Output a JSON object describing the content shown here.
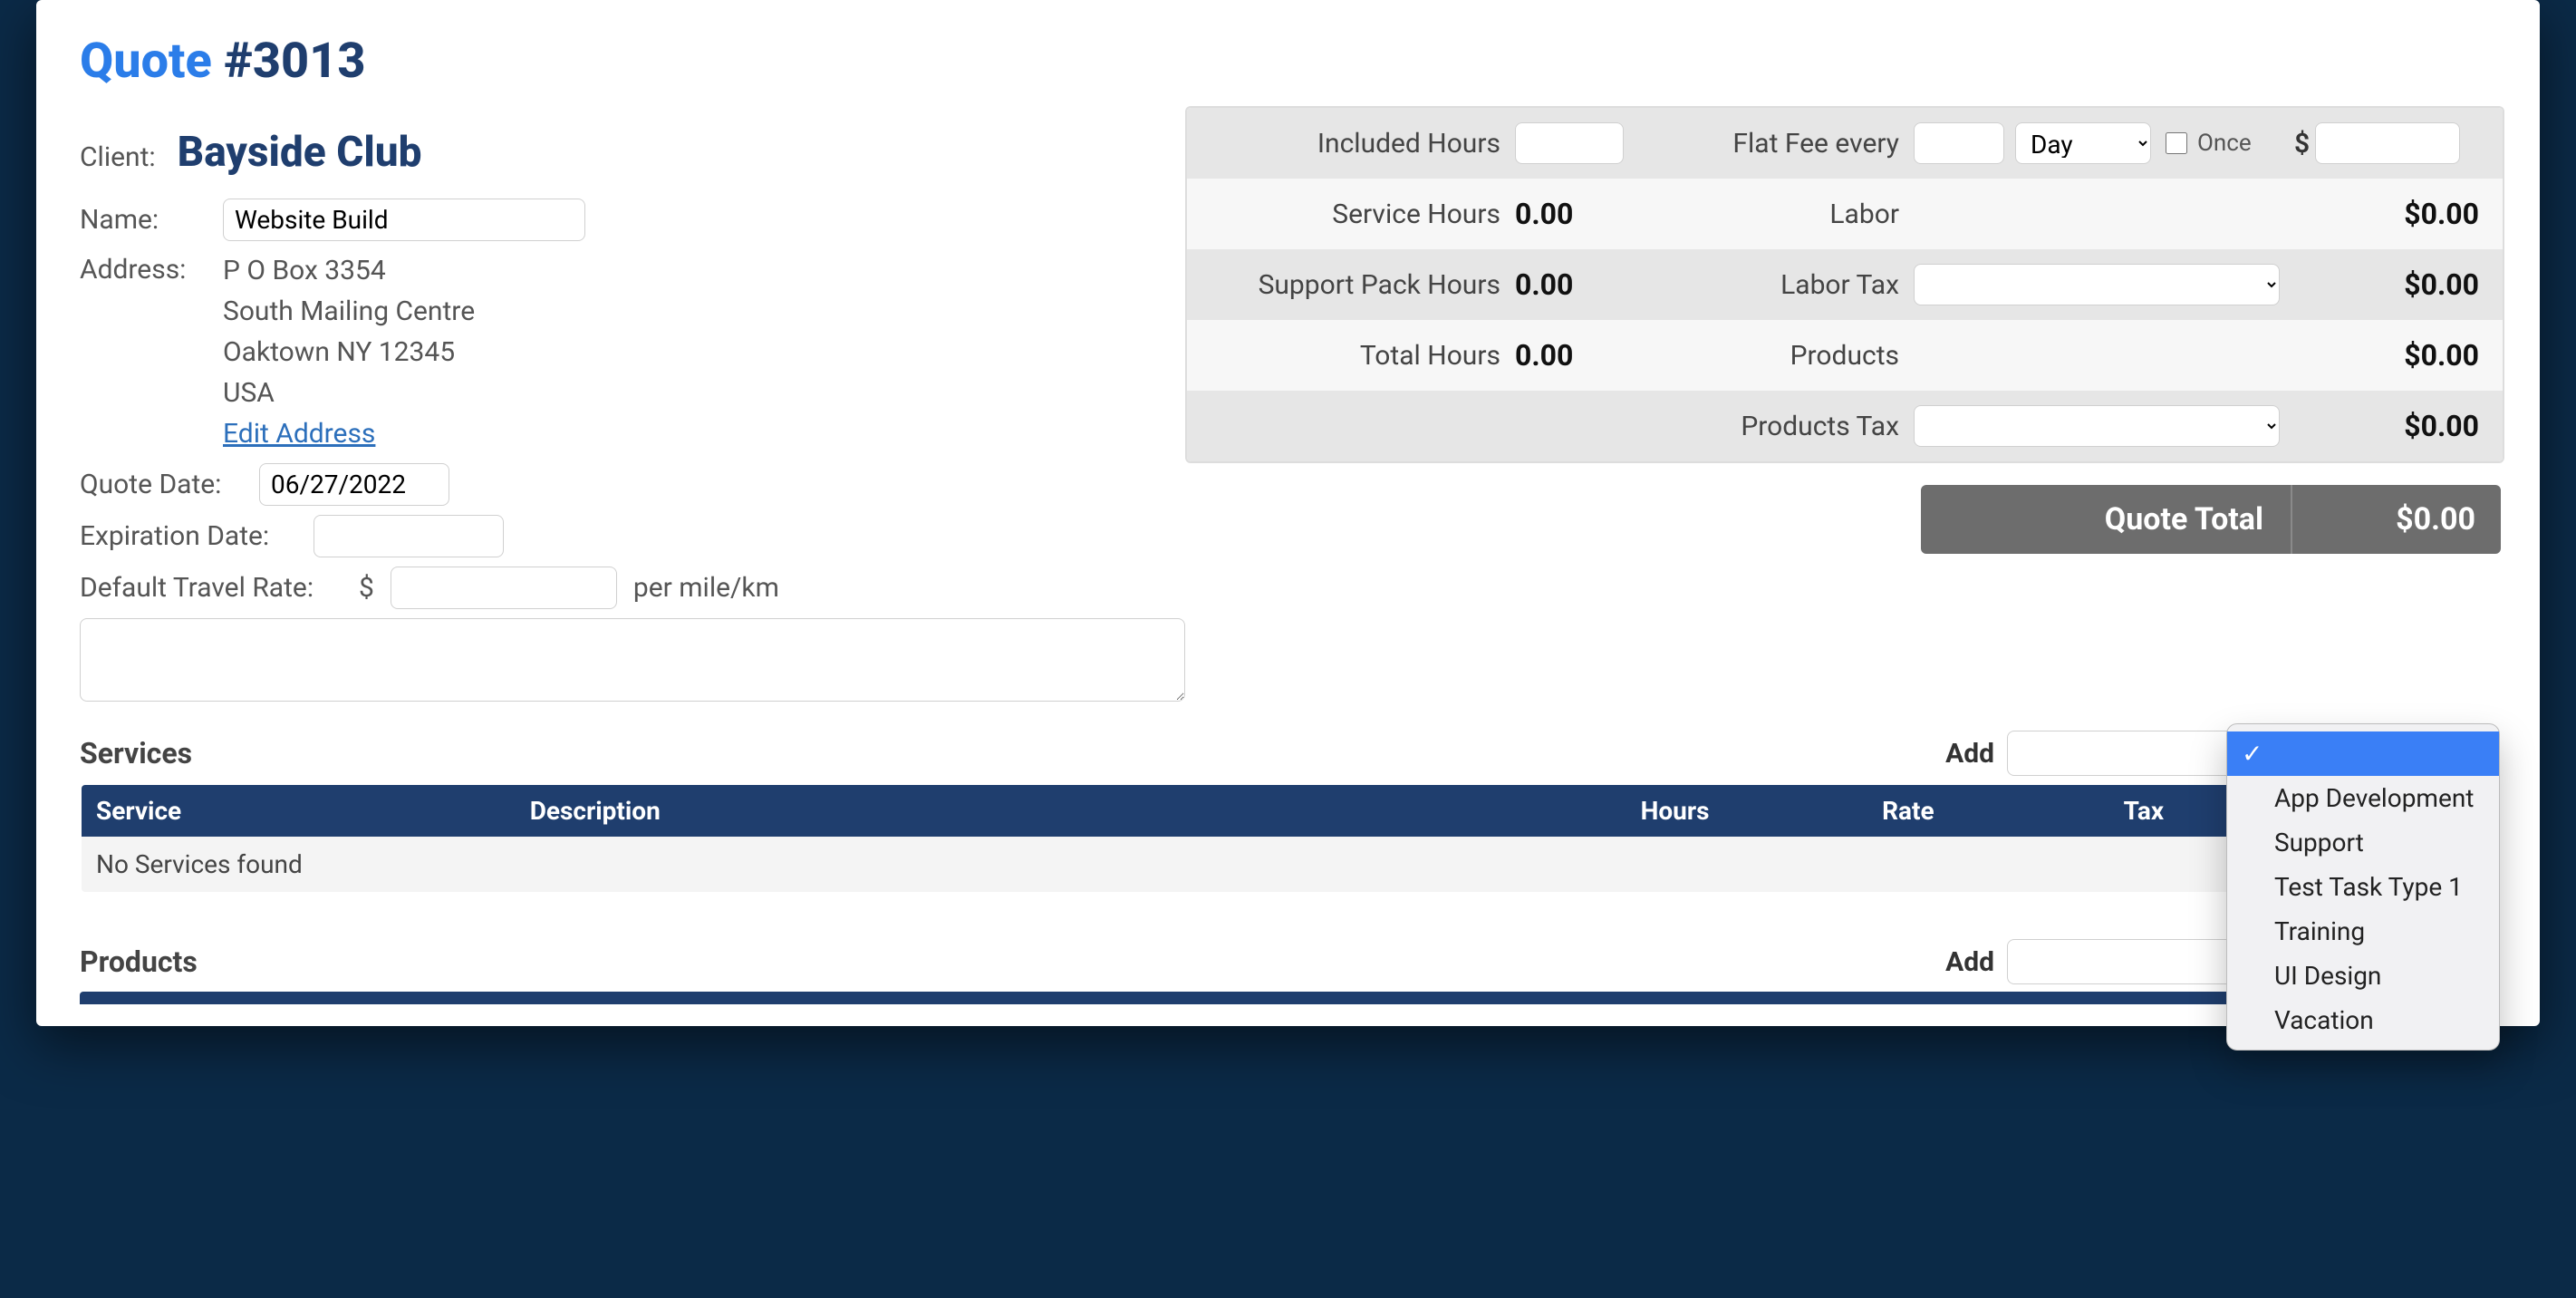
{
  "title": {
    "word": "Quote",
    "number": "#3013"
  },
  "client": {
    "label": "Client:",
    "name": "Bayside Club"
  },
  "form": {
    "name_label": "Name:",
    "name_value": "Website Build",
    "address_label": "Address:",
    "address_lines": {
      "l1": "P O Box 3354",
      "l2": "South Mailing Centre",
      "l3": "Oaktown NY 12345",
      "l4": "USA"
    },
    "edit_address": "Edit Address",
    "quote_date_label": "Quote Date:",
    "quote_date_value": "06/27/2022",
    "expiration_label": "Expiration Date:",
    "expiration_value": "",
    "travel_rate_label": "Default Travel Rate:",
    "travel_rate_currency": "$",
    "travel_rate_value": "",
    "travel_rate_unit": "per mile/km",
    "notes_value": ""
  },
  "summary": {
    "row1": {
      "included_hours_label": "Included Hours",
      "included_hours_value": "",
      "flat_fee_label": "Flat Fee every",
      "flat_fee_period": "Day",
      "once_label": "Once",
      "once_checked": false,
      "flat_fee_currency": "$",
      "flat_fee_amount": ""
    },
    "row2": {
      "service_hours_label": "Service Hours",
      "service_hours_value": "0.00",
      "labor_label": "Labor",
      "labor_amount": "$0.00"
    },
    "row3": {
      "support_hours_label": "Support Pack Hours",
      "support_hours_value": "0.00",
      "labor_tax_label": "Labor Tax",
      "labor_tax_selected": "",
      "labor_tax_amount": "$0.00"
    },
    "row4": {
      "total_hours_label": "Total Hours",
      "total_hours_value": "0.00",
      "products_label": "Products",
      "products_amount": "$0.00"
    },
    "row5": {
      "products_tax_label": "Products Tax",
      "products_tax_selected": "",
      "products_tax_amount": "$0.00"
    },
    "total": {
      "label": "Quote Total",
      "amount": "$0.00"
    }
  },
  "services": {
    "title": "Services",
    "add_label": "Add",
    "columns": {
      "service": "Service",
      "description": "Description",
      "hours": "Hours",
      "rate": "Rate",
      "tax": "Tax"
    },
    "empty": "No Services found",
    "dropdown": {
      "selected_index": 0,
      "options": {
        "o0": "",
        "o1": "App Development",
        "o2": "Support",
        "o3": "Test Task Type 1",
        "o4": "Training",
        "o5": "UI Design",
        "o6": "Vacation"
      }
    }
  },
  "products": {
    "title": "Products",
    "add_label": "Add",
    "add_value": ""
  }
}
